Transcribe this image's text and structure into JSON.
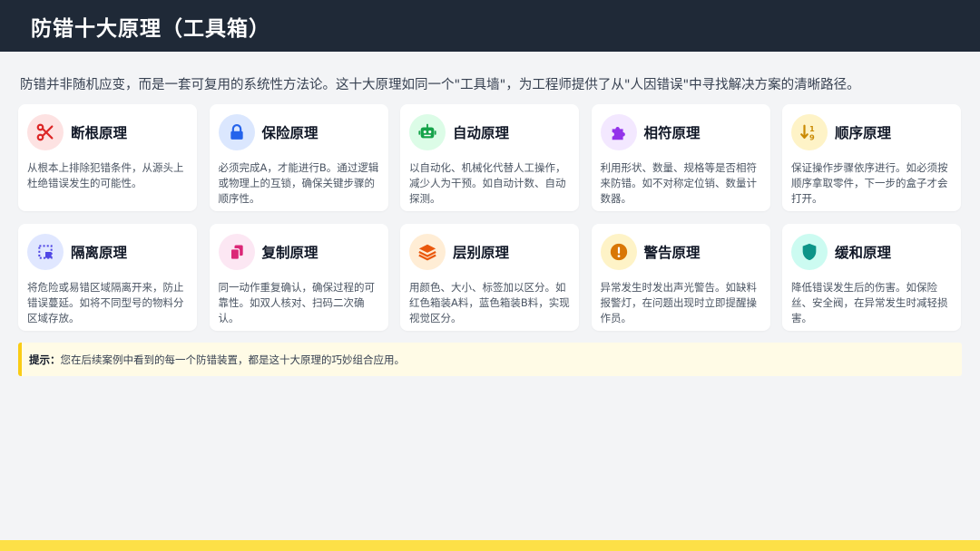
{
  "title": "防错十大原理（工具箱）",
  "intro": "防错并非随机应变，而是一套可复用的系统性方法论。这十大原理如同一个\"工具墙\"，为工程师提供了从\"人因错误\"中寻找解决方案的清晰路径。",
  "principles": [
    {
      "title": "断根原理",
      "desc": "从根本上排除犯错条件，从源头上杜绝错误发生的可能性。",
      "icon": "scissors-icon",
      "bg": "#fde2e2",
      "fg": "#dc2626"
    },
    {
      "title": "保险原理",
      "desc": "必须完成A，才能进行B。通过逻辑或物理上的互锁，确保关键步骤的顺序性。",
      "icon": "lock-icon",
      "bg": "#dbe7fe",
      "fg": "#2563eb"
    },
    {
      "title": "自动原理",
      "desc": "以自动化、机械化代替人工操作，减少人为干预。如自动计数、自动探测。",
      "icon": "robot-icon",
      "bg": "#dcfce7",
      "fg": "#16a34a"
    },
    {
      "title": "相符原理",
      "desc": "利用形状、数量、规格等是否相符来防错。如不对称定位销、数量计数器。",
      "icon": "puzzle-icon",
      "bg": "#f3e8ff",
      "fg": "#9333ea"
    },
    {
      "title": "顺序原理",
      "desc": "保证操作步骤依序进行。如必须按顺序拿取零件，下一步的盒子才会打开。",
      "icon": "sort-icon",
      "bg": "#fef3c7",
      "fg": "#ca8a04"
    },
    {
      "title": "隔离原理",
      "desc": "将危险或易错区域隔离开来，防止错误蔓延。如将不同型号的物料分区域存放。",
      "icon": "dashed-square-icon",
      "bg": "#e0e7ff",
      "fg": "#4f46e5"
    },
    {
      "title": "复制原理",
      "desc": "同一动作重复确认，确保过程的可靠性。如双人核对、扫码二次确认。",
      "icon": "copy-icon",
      "bg": "#fce7f3",
      "fg": "#db2777"
    },
    {
      "title": "层别原理",
      "desc": "用颜色、大小、标签加以区分。如红色箱装A料，蓝色箱装B料，实现视觉区分。",
      "icon": "layers-icon",
      "bg": "#ffedd5",
      "fg": "#ea580c"
    },
    {
      "title": "警告原理",
      "desc": "异常发生时发出声光警告。如缺料报警灯，在问题出现时立即提醒操作员。",
      "icon": "exclamation-icon",
      "bg": "#fef3c7",
      "fg": "#d97706"
    },
    {
      "title": "缓和原理",
      "desc": "降低错误发生后的伤害。如保险丝、安全阀，在异常发生时减轻损害。",
      "icon": "shield-icon",
      "bg": "#ccfbf1",
      "fg": "#0d9488"
    }
  ],
  "tip": {
    "label": "提示：",
    "text": "您在后续案例中看到的每一个防错装置，都是这十大原理的巧妙组合应用。"
  },
  "colors": {
    "header_bg": "#1f2937",
    "accent": "#facc15"
  }
}
